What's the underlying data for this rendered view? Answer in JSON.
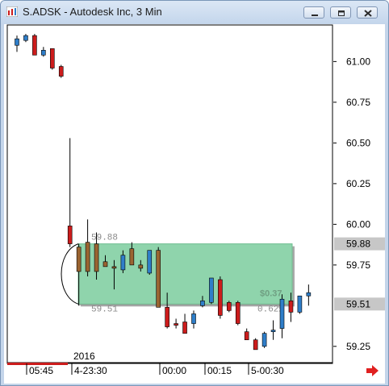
{
  "window": {
    "title": "S.ADSK - Autodesk Inc, 3 Min",
    "icon": "chart-app-icon",
    "buttons": [
      "minimize-icon",
      "restore-icon",
      "close-icon"
    ]
  },
  "chart_data": {
    "type": "candlestick",
    "symbol": "S.ADSK",
    "interval": "3 Min",
    "yticks": [
      "61.00",
      "60.75",
      "60.50",
      "60.25",
      "60.00",
      "59.75",
      "59.25"
    ],
    "ylim": [
      59.15,
      61.225
    ],
    "xticks": [
      "05:45",
      "4-23:30",
      "00:00",
      "00:15",
      "5-00:30"
    ],
    "date_label": "2016",
    "price_tags": [
      "59.88",
      "59.51"
    ],
    "zone": {
      "top": 59.88,
      "bottom": 59.51,
      "top_label": "59.88",
      "bottom_label": "59.51",
      "change_label": "$0.37",
      "pct_label": "0.62%",
      "color": "#8fd4ac"
    },
    "colors": {
      "up": "#2f7ec9",
      "down": "#cc1c1c",
      "neutral": "#9a6431",
      "grid": "#999999"
    },
    "candles": [
      {
        "o": 61.1,
        "h": 61.16,
        "l": 61.06,
        "c": 61.14
      },
      {
        "o": 61.13,
        "h": 61.17,
        "l": 61.12,
        "c": 61.16
      },
      {
        "o": 61.16,
        "h": 61.17,
        "l": 61.04,
        "c": 61.04
      },
      {
        "o": 61.04,
        "h": 61.09,
        "l": 61.03,
        "c": 61.07
      },
      {
        "o": 61.08,
        "h": 61.08,
        "l": 60.95,
        "c": 60.96
      },
      {
        "o": 60.97,
        "h": 60.98,
        "l": 60.9,
        "c": 60.91
      },
      {
        "o": 59.99,
        "h": 60.53,
        "l": 59.86,
        "c": 59.88
      },
      {
        "o": 59.86,
        "h": 59.88,
        "l": 59.5,
        "c": 59.71
      },
      {
        "o": 59.71,
        "h": 60.03,
        "l": 59.68,
        "c": 59.89
      },
      {
        "o": 59.88,
        "h": 59.95,
        "l": 59.66,
        "c": 59.71
      },
      {
        "o": 59.77,
        "h": 59.81,
        "l": 59.74,
        "c": 59.74
      },
      {
        "o": 59.74,
        "h": 59.78,
        "l": 59.6,
        "c": 59.74
      },
      {
        "o": 59.72,
        "h": 59.84,
        "l": 59.7,
        "c": 59.81
      },
      {
        "o": 59.85,
        "h": 59.89,
        "l": 59.75,
        "c": 59.75
      },
      {
        "o": 59.75,
        "h": 59.78,
        "l": 59.71,
        "c": 59.73
      },
      {
        "o": 59.7,
        "h": 59.84,
        "l": 59.69,
        "c": 59.84
      },
      {
        "o": 59.84,
        "h": 59.86,
        "l": 59.49,
        "c": 59.49
      },
      {
        "o": 59.49,
        "h": 59.58,
        "l": 59.36,
        "c": 59.37
      },
      {
        "o": 59.39,
        "h": 59.42,
        "l": 59.36,
        "c": 59.38
      },
      {
        "o": 59.4,
        "h": 59.45,
        "l": 59.35,
        "c": 59.33
      },
      {
        "o": 59.39,
        "h": 59.47,
        "l": 59.36,
        "c": 59.45
      },
      {
        "o": 59.5,
        "h": 59.56,
        "l": 59.49,
        "c": 59.53
      },
      {
        "o": 59.52,
        "h": 59.67,
        "l": 59.51,
        "c": 59.67
      },
      {
        "o": 59.66,
        "h": 59.68,
        "l": 59.42,
        "c": 59.44
      },
      {
        "o": 59.52,
        "h": 59.53,
        "l": 59.46,
        "c": 59.47
      },
      {
        "o": 59.52,
        "h": 59.53,
        "l": 59.38,
        "c": 59.39
      },
      {
        "o": 59.34,
        "h": 59.36,
        "l": 59.3,
        "c": 59.29
      },
      {
        "o": 59.29,
        "h": 59.3,
        "l": 59.23,
        "c": 59.23
      },
      {
        "o": 59.25,
        "h": 59.34,
        "l": 59.24,
        "c": 59.33
      },
      {
        "o": 59.34,
        "h": 59.41,
        "l": 59.29,
        "c": 59.35
      },
      {
        "o": 59.36,
        "h": 59.57,
        "l": 59.3,
        "c": 59.54
      },
      {
        "o": 59.53,
        "h": 59.58,
        "l": 59.4,
        "c": 59.46
      },
      {
        "o": 59.46,
        "h": 59.56,
        "l": 59.45,
        "c": 59.56
      },
      {
        "o": 59.56,
        "h": 59.63,
        "l": 59.5,
        "c": 59.58
      }
    ]
  }
}
